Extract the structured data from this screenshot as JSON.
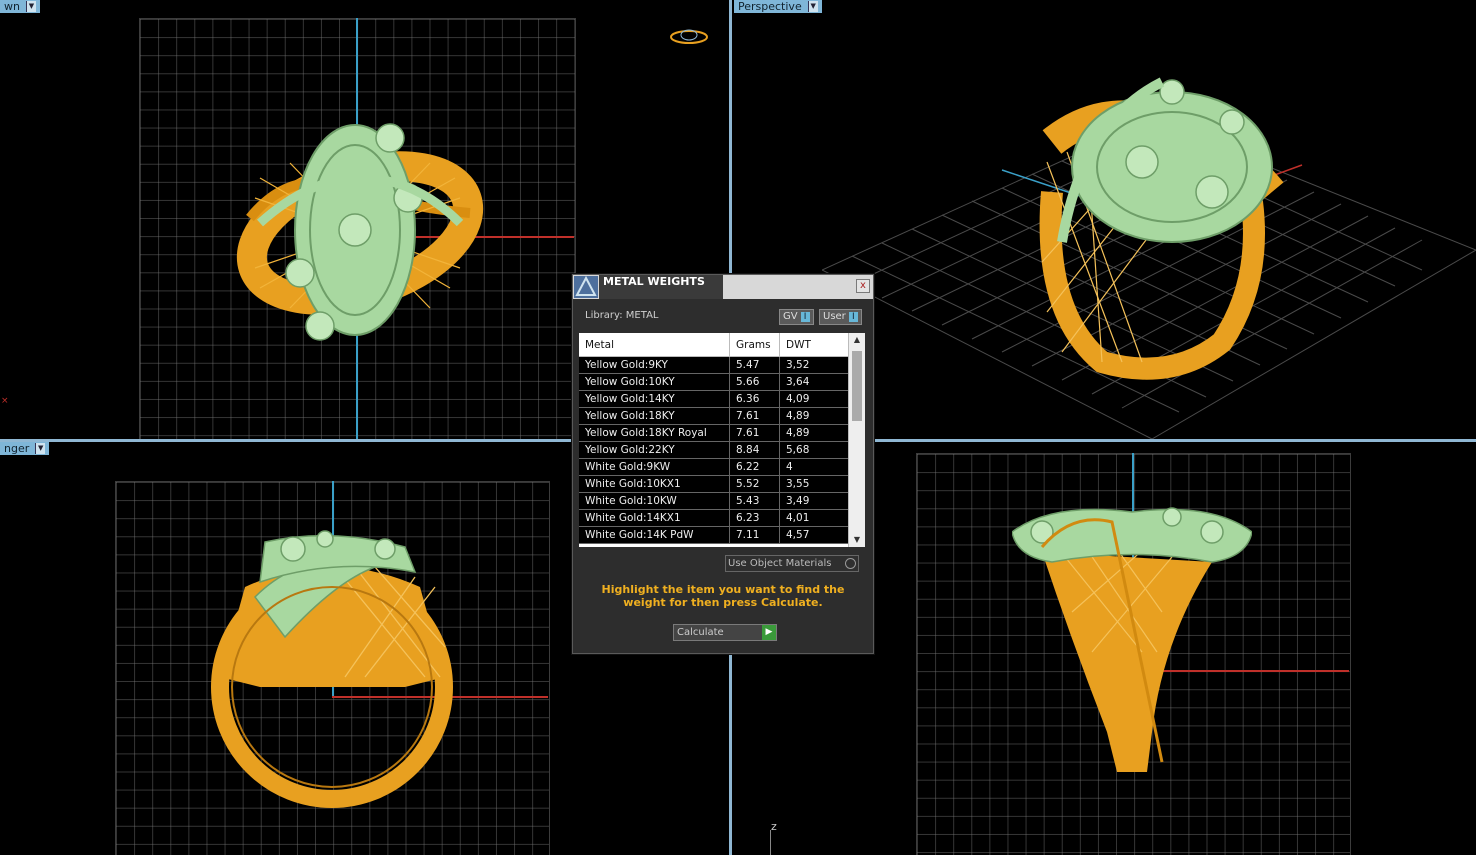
{
  "viewports": {
    "top_left": {
      "label": "wn"
    },
    "top_right": {
      "label": "Perspective"
    },
    "bottom_left": {
      "label": "nger"
    },
    "bottom_right": {
      "label": ""
    },
    "z_axis_label": "z"
  },
  "colors": {
    "gold": "#e8a020",
    "jade": "#a8d8a0",
    "grid": "#505050",
    "axis_x": "#c0302a",
    "axis_y": "#3aa0c8",
    "divider": "#8fb7d3"
  },
  "dialog": {
    "title": "METAL WEIGHTS",
    "close_label": "x",
    "library_label": "Library: METAL",
    "toggle_gv": "GV",
    "toggle_user": "User",
    "toggle_indicator": "I",
    "columns": [
      "Metal",
      "Grams",
      "DWT"
    ],
    "rows": [
      [
        "Yellow Gold:9KY",
        "5.47",
        "3,52"
      ],
      [
        "Yellow Gold:10KY",
        "5.66",
        "3,64"
      ],
      [
        "Yellow Gold:14KY",
        "6.36",
        "4,09"
      ],
      [
        "Yellow Gold:18KY",
        "7.61",
        "4,89"
      ],
      [
        "Yellow Gold:18KY Royal",
        "7.61",
        "4,89"
      ],
      [
        "Yellow Gold:22KY",
        "8.84",
        "5,68"
      ],
      [
        "White Gold:9KW",
        "6.22",
        "4"
      ],
      [
        "White Gold:10KX1",
        "5.52",
        "3,55"
      ],
      [
        "White Gold:10KW",
        "5.43",
        "3,49"
      ],
      [
        "White Gold:14KX1",
        "6.23",
        "4,01"
      ],
      [
        "White Gold:14K PdW",
        "7.11",
        "4,57"
      ]
    ],
    "use_object_materials": "Use Object Materials",
    "hint": "Highlight the item you want to find the weight for then press Calculate.",
    "calculate_label": "Calculate"
  }
}
